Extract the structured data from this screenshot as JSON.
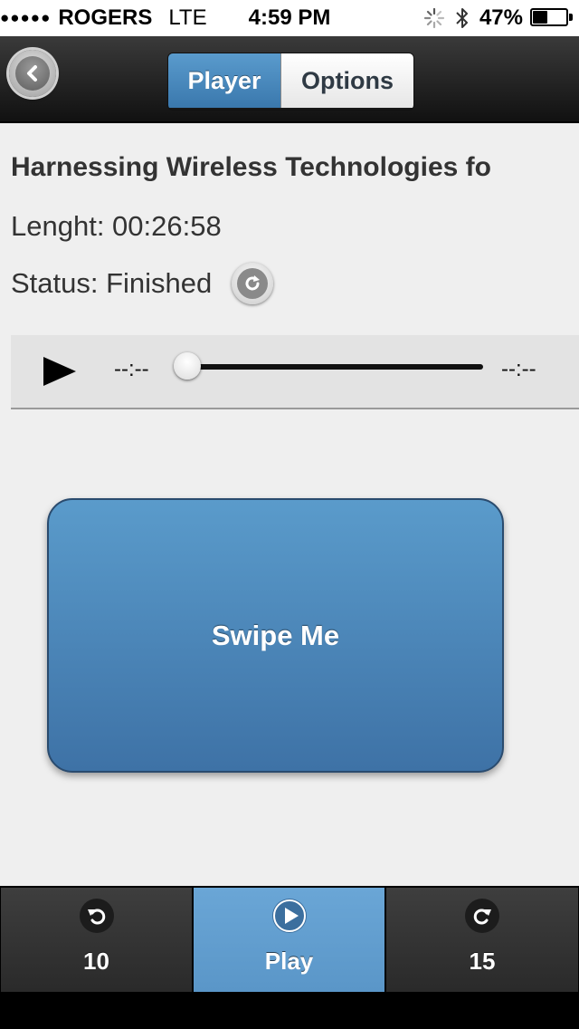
{
  "status_bar": {
    "signal": "●●●●●",
    "carrier": "ROGERS",
    "network": "LTE",
    "time": "4:59 PM",
    "battery_percent": "47%",
    "battery_level": 0.47
  },
  "nav": {
    "tabs": [
      {
        "label": "Player",
        "active": true
      },
      {
        "label": "Options",
        "active": false
      }
    ]
  },
  "episode": {
    "title": "Harnessing Wireless Technologies fo",
    "length_text": "Lenght: 00:26:58",
    "status_text": "Status: Finished"
  },
  "player": {
    "current_time": "--:--",
    "total_time": "--:--",
    "progress": 0
  },
  "swipe": {
    "label": "Swipe Me"
  },
  "toolbar": {
    "items": [
      {
        "label": "10",
        "icon": "rewind-icon",
        "active": false
      },
      {
        "label": "Play",
        "icon": "play-icon",
        "active": true
      },
      {
        "label": "15",
        "icon": "forward-icon",
        "active": false
      }
    ]
  },
  "colors": {
    "accent": "#4d8dc3",
    "nav_bg": "#1a1a1a",
    "page_bg": "#efefef"
  }
}
